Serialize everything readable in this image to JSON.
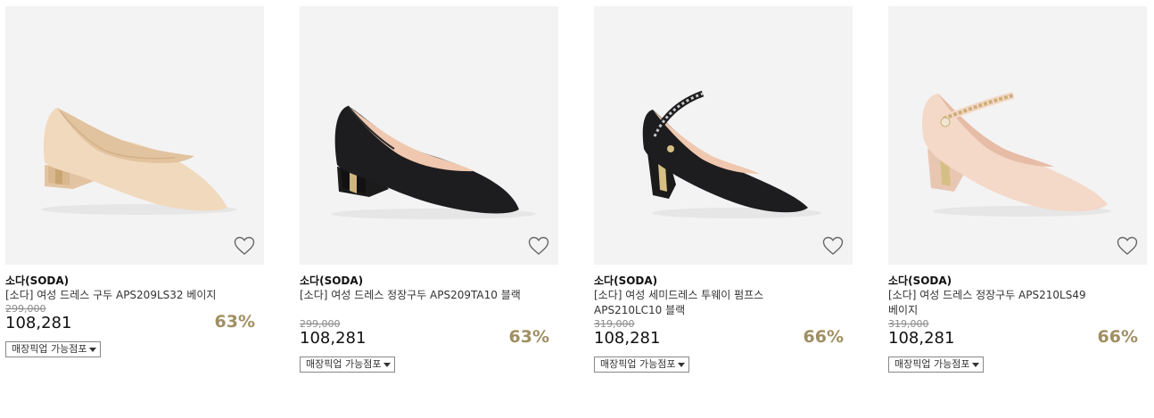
{
  "colors": {
    "image_bg": "#f3f3f3",
    "discount": "#a08f63",
    "beige": "#f1d9bd",
    "black": "#1c1c1e",
    "pink_beige": "#f4d8c8",
    "gold": "#c9b37a"
  },
  "products": [
    {
      "image": "beige-pump-shoe",
      "brand": "소다(SODA)",
      "name": "[소다] 여성 드레스 구두 APS209LS32 베이지",
      "original_price": "299,000",
      "price": "108,281",
      "discount": "63%",
      "pickup_label": "매장픽업 가능점포",
      "wishlist_icon": "heart-outline-icon"
    },
    {
      "image": "black-pump-shoe",
      "brand": "소다(SODA)",
      "name": "[소다] 여성 드레스 정장구두 APS209TA10 블랙",
      "original_price": "299,000",
      "price": "108,281",
      "discount": "63%",
      "pickup_label": "매장픽업 가능점포",
      "wishlist_icon": "heart-outline-icon"
    },
    {
      "image": "black-strap-pump-shoe",
      "brand": "소다(SODA)",
      "name": "[소다] 여성 세미드레스 투웨이 펌프스 APS210LC10 블랙",
      "original_price": "319,000",
      "price": "108,281",
      "discount": "66%",
      "pickup_label": "매장픽업 가능점포",
      "wishlist_icon": "heart-outline-icon"
    },
    {
      "image": "beige-strap-pump-shoe",
      "brand": "소다(SODA)",
      "name": "[소다] 여성 드레스 정장구두 APS210LS49 베이지",
      "original_price": "319,000",
      "price": "108,281",
      "discount": "66%",
      "pickup_label": "매장픽업 가능점포",
      "wishlist_icon": "heart-outline-icon"
    }
  ]
}
